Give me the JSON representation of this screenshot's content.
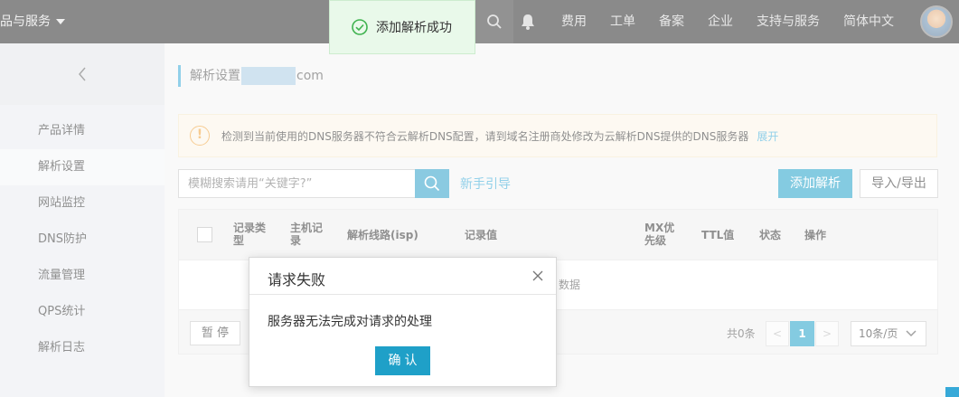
{
  "topbar": {
    "products_label": "品与服务",
    "nav": [
      "费用",
      "工单",
      "备案",
      "企业",
      "支持与服务",
      "简体中文"
    ]
  },
  "toast": {
    "text": "添加解析成功"
  },
  "sidebar": {
    "items": [
      {
        "label": "产品详情",
        "active": false
      },
      {
        "label": "解析设置",
        "active": true
      },
      {
        "label": "网站监控",
        "active": false
      },
      {
        "label": "DNS防护",
        "active": false
      },
      {
        "label": "流量管理",
        "active": false
      },
      {
        "label": "QPS统计",
        "active": false
      },
      {
        "label": "解析日志",
        "active": false
      }
    ]
  },
  "breadcrumb": {
    "prefix": "解析设置",
    "suffix": "com"
  },
  "alert": {
    "text": "检测到当前使用的DNS服务器不符合云解析DNS配置，请到域名注册商处修改为云解析DNS提供的DNS服务器",
    "link": "展开"
  },
  "toolbar": {
    "search_placeholder": "模糊搜索请用“关键字?”",
    "guide_link": "新手引导",
    "add_button": "添加解析",
    "io_button": "导入/导出"
  },
  "table": {
    "columns": [
      "记录类型",
      "主机记录",
      "解析线路(isp)",
      "记录值",
      "MX优先级",
      "TTL值",
      "状态",
      "操作"
    ],
    "empty_text": "数据"
  },
  "footer": {
    "pause_button": "暂 停",
    "total": "共0条",
    "prev": "<",
    "current_page": "1",
    "next": ">",
    "page_size": "10条/页"
  },
  "modal": {
    "title": "请求失败",
    "message": "服务器无法完成对请求的处理",
    "ok_button": "确认"
  },
  "colors": {
    "accent": "#1fa0c8",
    "topbar": "#2b2b2b",
    "toast_bg": "#e9f9ea",
    "success_green": "#3fb34f",
    "warning_orange": "#f0a23a"
  }
}
